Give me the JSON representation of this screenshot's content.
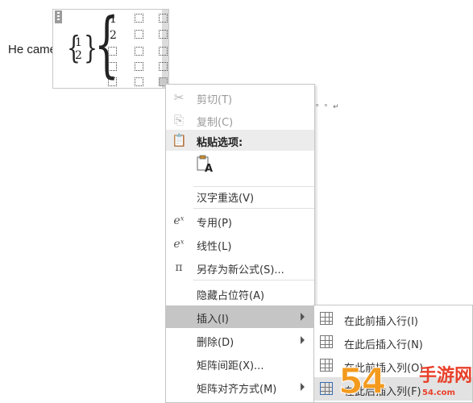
{
  "document": {
    "text": "He came",
    "fraction": {
      "numerator": "1",
      "denominator": "2"
    },
    "matrix_values": [
      "1",
      "2"
    ]
  },
  "context_menu": {
    "items": [
      {
        "label": "剪切(T)",
        "icon": "scissors-icon",
        "state": "disabled"
      },
      {
        "label": "复制(C)",
        "icon": "copy-icon",
        "state": "disabled"
      },
      {
        "label": "粘贴选项:",
        "icon": "clipboard-icon",
        "state": "section"
      },
      {
        "label": "汉字重选(V)",
        "icon": "",
        "state": "normal"
      },
      {
        "label": "专用(P)",
        "icon": "professional-equation-icon",
        "state": "normal"
      },
      {
        "label": "线性(L)",
        "icon": "linear-equation-icon",
        "state": "normal"
      },
      {
        "label": "另存为新公式(S)...",
        "icon": "save-equation-pi-icon",
        "state": "normal"
      },
      {
        "label": "隐藏占位符(A)",
        "icon": "",
        "state": "normal"
      },
      {
        "label": "插入(I)",
        "icon": "",
        "state": "highlighted",
        "submenu": true
      },
      {
        "label": "删除(D)",
        "icon": "",
        "state": "normal",
        "submenu": true
      },
      {
        "label": "矩阵间距(X)...",
        "icon": "",
        "state": "normal"
      },
      {
        "label": "矩阵对齐方式(M)",
        "icon": "",
        "state": "normal",
        "submenu": true
      }
    ],
    "paste_option_icon": "paste-keep-text-icon",
    "paste_option_letter": "A"
  },
  "submenu": {
    "items": [
      {
        "label": "在此前插入行(I)",
        "icon": "insert-row-above-icon"
      },
      {
        "label": "在此后插入行(N)",
        "icon": "insert-row-below-icon"
      },
      {
        "label": "在此前插入列(O)",
        "icon": "insert-column-before-icon"
      },
      {
        "label": "在此后插入列(F)",
        "icon": "insert-column-after-icon"
      }
    ]
  },
  "watermark": {
    "number": "54",
    "cn": "手游网",
    "url": "54.com"
  },
  "colors": {
    "menu_highlight": "#c5c5c5",
    "section_bg": "#ececec",
    "disabled_text": "#9a9a9a",
    "watermark_orange": "#f39a1e",
    "watermark_red": "#e8402a"
  }
}
